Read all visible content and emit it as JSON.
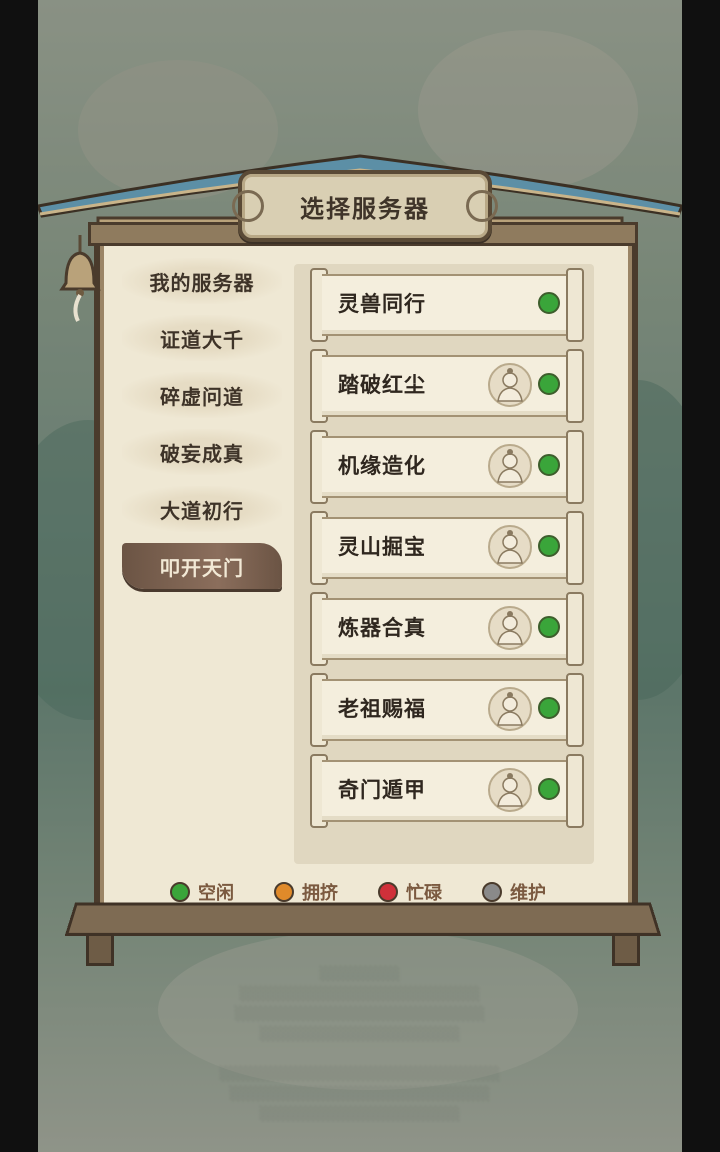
{
  "dialog": {
    "title": "选择服务器"
  },
  "tabs": [
    {
      "label": "我的服务器",
      "active": false
    },
    {
      "label": "证道大千",
      "active": false
    },
    {
      "label": "碎虚问道",
      "active": false
    },
    {
      "label": "破妄成真",
      "active": false
    },
    {
      "label": "大道初行",
      "active": false
    },
    {
      "label": "叩开天门",
      "active": true
    }
  ],
  "servers": [
    {
      "name": "灵兽同行",
      "has_avatar": false,
      "status": "idle"
    },
    {
      "name": "踏破红尘",
      "has_avatar": true,
      "status": "idle"
    },
    {
      "name": "机缘造化",
      "has_avatar": true,
      "status": "idle"
    },
    {
      "name": "灵山掘宝",
      "has_avatar": true,
      "status": "idle"
    },
    {
      "name": "炼器合真",
      "has_avatar": true,
      "status": "idle"
    },
    {
      "name": "老祖赐福",
      "has_avatar": true,
      "status": "idle"
    },
    {
      "name": "奇门遁甲",
      "has_avatar": true,
      "status": "idle"
    }
  ],
  "legend": [
    {
      "label": "空闲",
      "color": "#3aa53a",
      "key": "idle"
    },
    {
      "label": "拥挤",
      "color": "#e08a2a",
      "key": "crowded"
    },
    {
      "label": "忙碌",
      "color": "#d0303a",
      "key": "busy"
    },
    {
      "label": "维护",
      "color": "#8a8a8a",
      "key": "maintenance"
    }
  ],
  "colors": {
    "status_idle": "#3aa53a",
    "frame_dark": "#4a3b2c",
    "paper": "#efe8d4",
    "active_tab": "#7b6050"
  }
}
